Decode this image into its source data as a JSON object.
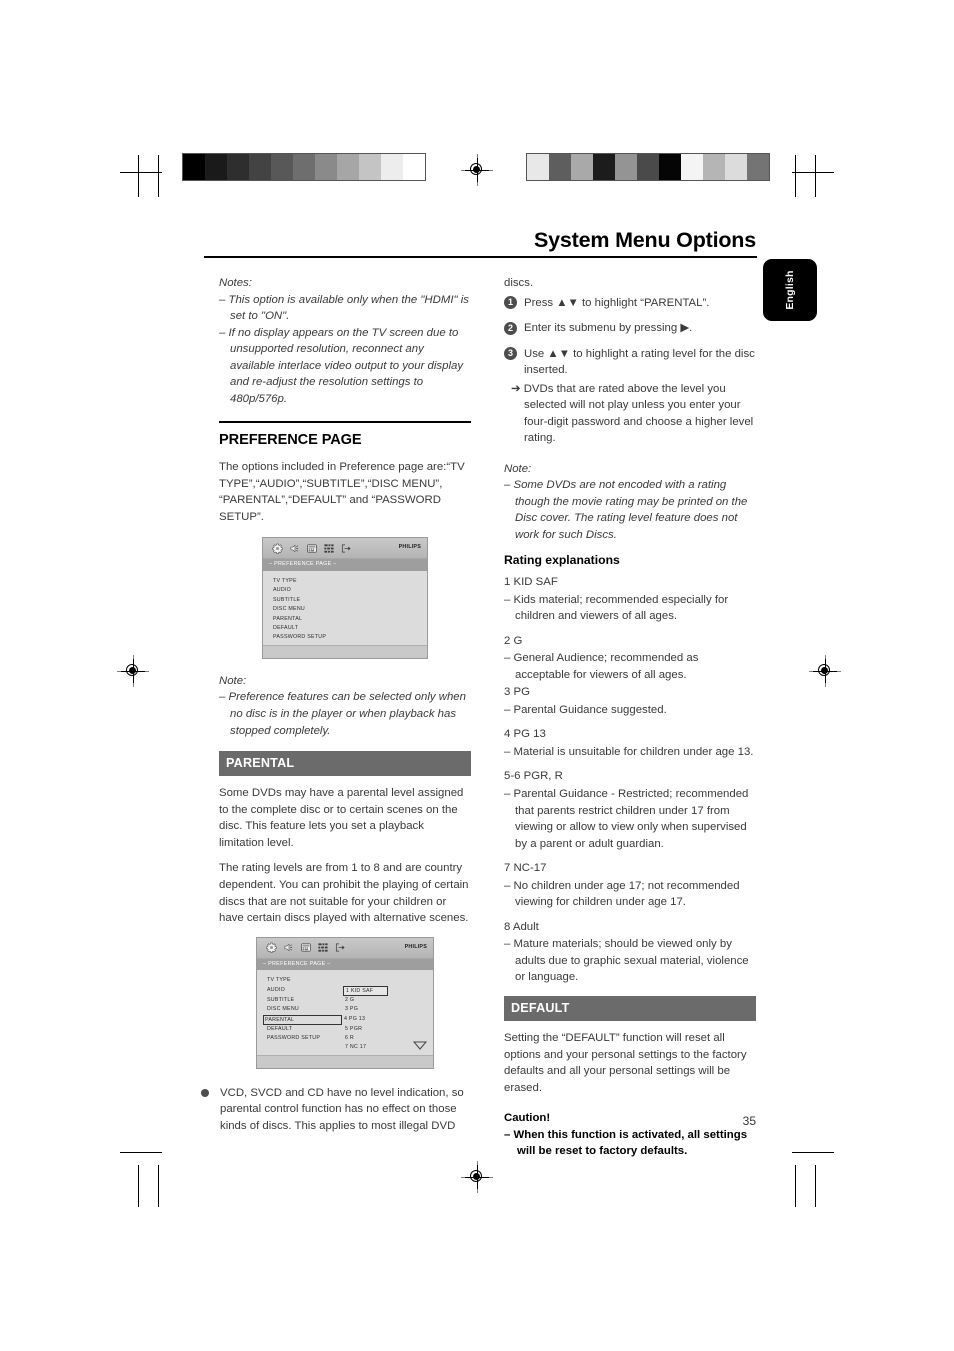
{
  "header": {
    "title": "System Menu Options",
    "language_tab": "English"
  },
  "page_number": "35",
  "left_column": {
    "notes_top": {
      "label": "Notes:",
      "items": [
        "–   This option is available only when the \"HDMI\" is set to \"ON\".",
        "–   If no display appears on the TV screen due to unsupported resolution, reconnect any available interlace video output to your display and re-adjust the resolution settings to 480p/576p."
      ]
    },
    "preference_heading": "PREFERENCE PAGE",
    "preference_intro": "The options included in Preference page are:“TV TYPE”,“AUDIO”,“SUBTITLE”,“DISC MENU”, “PARENTAL”,“DEFAULT” and “PASSWORD SETUP”.",
    "osd_preference": {
      "brand": "PHILIPS",
      "subtitle": "– PREFERENCE PAGE –",
      "icons": [
        "gear-icon",
        "speaker-icon",
        "display-icon",
        "preference-grid-icon",
        "exit-icon"
      ],
      "items": [
        "TV TYPE",
        "AUDIO",
        "SUBTITLE",
        "DISC MENU",
        "PARENTAL",
        "DEFAULT",
        "PASSWORD SETUP"
      ]
    },
    "note_mid": {
      "label": "Note:",
      "text": "–   Preference features can be selected only when no disc is in the player or when playback has stopped completely."
    },
    "parental_bar": "PARENTAL",
    "parental_p1": "Some DVDs may have a parental level assigned to the complete disc or to certain scenes on the disc. This feature lets you set a playback limitation level.",
    "parental_p2": "The rating levels are from 1 to 8 and are country dependent. You can prohibit the playing of certain discs that are not suitable for your children or have certain discs played with alternative scenes.",
    "osd_parental": {
      "brand": "PHILIPS",
      "subtitle": "– PREFERENCE PAGE –",
      "icons": [
        "gear-icon",
        "speaker-icon",
        "display-icon",
        "preference-grid-icon",
        "exit-icon"
      ],
      "items": [
        "TV TYPE",
        "AUDIO",
        "SUBTITLE",
        "DISC MENU",
        "PARENTAL",
        "DEFAULT",
        "PASSWORD SETUP"
      ],
      "highlighted_item": "PARENTAL",
      "ratings": [
        "1 KID SAF",
        "2 G",
        "3 PG",
        "4 PG 13",
        "5 PGR",
        "6 R",
        "7 NC 17"
      ],
      "selected_rating": "1 KID SAF",
      "scroll_indicator": "caret-down-icon"
    },
    "bullet_text": "VCD, SVCD and CD have no level indication, so parental control function has no effect on those kinds of discs. This applies to most illegal DVD"
  },
  "right_column": {
    "continued_word": "discs.",
    "steps": [
      {
        "num": "1",
        "text": "Press ▲▼ to highlight “PARENTAL”."
      },
      {
        "num": "2",
        "text": "Enter its submenu by pressing ▶."
      },
      {
        "num": "3",
        "text": "Use ▲▼ to highlight a rating level for the disc inserted."
      }
    ],
    "step_arrow": "➔ DVDs that are rated above the level you selected will not play unless you enter your four-digit password and choose a higher level rating.",
    "note": {
      "label": "Note:",
      "text": "–   Some DVDs are not encoded with a rating though the movie rating may be printed on the Disc cover. The rating level feature does not work for such Discs."
    },
    "rating_explanations_heading": "Rating explanations",
    "rating_explanations": [
      {
        "name": "1 KID SAF",
        "desc": "–   Kids material; recommended especially for children and viewers of all ages."
      },
      {
        "name": "2 G",
        "desc": "–   General Audience; recommended as acceptable for viewers of all ages."
      },
      {
        "name": "3 PG",
        "desc": "–   Parental Guidance suggested."
      },
      {
        "name": "4 PG 13",
        "desc": "–   Material is unsuitable for children under age 13."
      },
      {
        "name": "5-6 PGR, R",
        "desc": "–   Parental Guidance - Restricted; recommended that parents restrict children under 17 from viewing or allow to view only when supervised by a parent or adult guardian."
      },
      {
        "name": "7 NC-17",
        "desc": "–   No children under age 17; not recommended viewing for children under age 17."
      },
      {
        "name": "8 Adult",
        "desc": "–   Mature materials; should be viewed only by adults due to graphic sexual material, violence or language."
      }
    ],
    "default_bar": "DEFAULT",
    "default_text": "Setting the “DEFAULT” function will reset all options and your personal settings to the factory defaults and all your personal settings will be erased.",
    "caution_label": "Caution!",
    "caution_text": "–   When this function is activated, all settings will be reset to factory defaults."
  },
  "print_marks": {
    "calibration_left": [
      "#000000",
      "#1a1a1a",
      "#2e2e2e",
      "#434343",
      "#585858",
      "#6e6e6e",
      "#8a8a8a",
      "#a6a6a6",
      "#c4c4c4",
      "#ededed",
      "#ffffff"
    ],
    "calibration_right": [
      "#e8e8e8",
      "#5e5e5e",
      "#a9a9a9",
      "#1c1c1c",
      "#949494",
      "#4a4a4a",
      "#050505",
      "#f4f4f4",
      "#b5b5b5",
      "#dcdcdc",
      "#747474"
    ]
  }
}
